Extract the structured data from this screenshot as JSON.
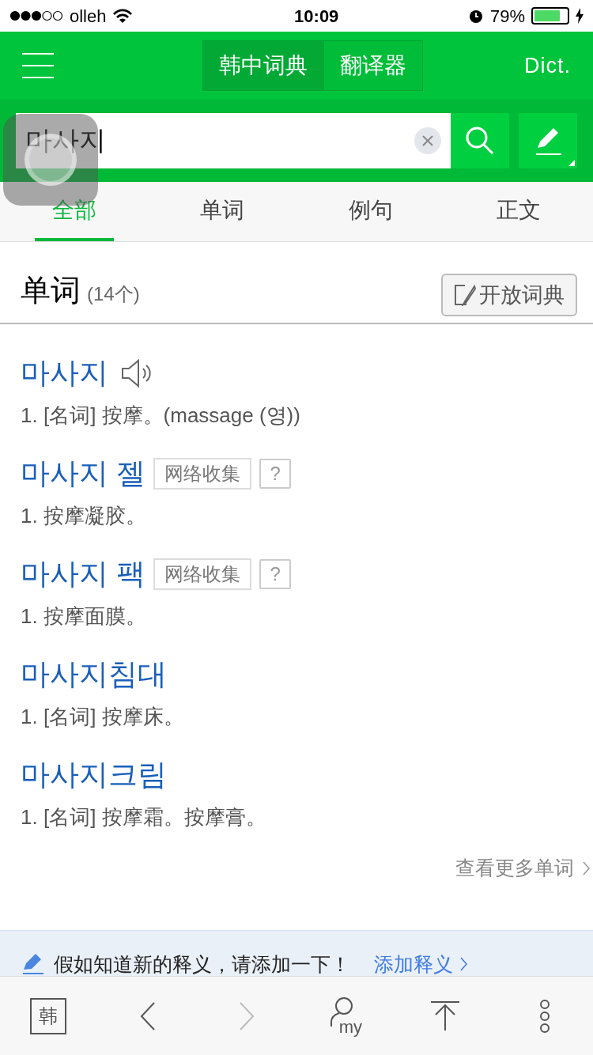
{
  "status_bar": {
    "carrier": "olleh",
    "time": "10:09",
    "battery": "79%"
  },
  "header": {
    "mode_tabs": [
      {
        "label": "韩中词典",
        "selected": true
      },
      {
        "label": "翻译器",
        "selected": false
      }
    ],
    "brand": "Dict."
  },
  "search": {
    "value": "마사지"
  },
  "result_tabs": [
    {
      "label": "全部",
      "selected": true
    },
    {
      "label": "单词",
      "selected": false
    },
    {
      "label": "例句",
      "selected": false
    },
    {
      "label": "正文",
      "selected": false
    }
  ],
  "section": {
    "title": "单词",
    "count": "(14个)",
    "open_dict_button": "开放词典"
  },
  "entries": [
    {
      "headword": "마사지",
      "audio": true,
      "definition": "1. [名词] 按摩。(massage (영))"
    },
    {
      "headword": "마사지 젤",
      "audio": false,
      "tag": "网络收集",
      "help": "?",
      "definition": "1. 按摩凝胶。"
    },
    {
      "headword": "마사지 팩",
      "audio": false,
      "tag": "网络收集",
      "help": "?",
      "definition": "1. 按摩面膜。"
    },
    {
      "headword": "마사지침대",
      "audio": false,
      "definition": "1. [名词] 按摩床。"
    },
    {
      "headword": "마사지크림",
      "audio": false,
      "definition": "1. [名词] 按摩霜。按摩膏。"
    }
  ],
  "more_link": "查看更多单词",
  "banner": {
    "text": "假如知道新的释义，请添加一下！",
    "link": "添加释义"
  },
  "bottom_bar": [
    {
      "kind": "lang",
      "label": "韩",
      "disabled": false
    },
    {
      "kind": "back",
      "disabled": false
    },
    {
      "kind": "forward",
      "disabled": true
    },
    {
      "kind": "my",
      "label": "my",
      "disabled": false
    },
    {
      "kind": "top",
      "disabled": false
    },
    {
      "kind": "more",
      "disabled": false
    }
  ]
}
